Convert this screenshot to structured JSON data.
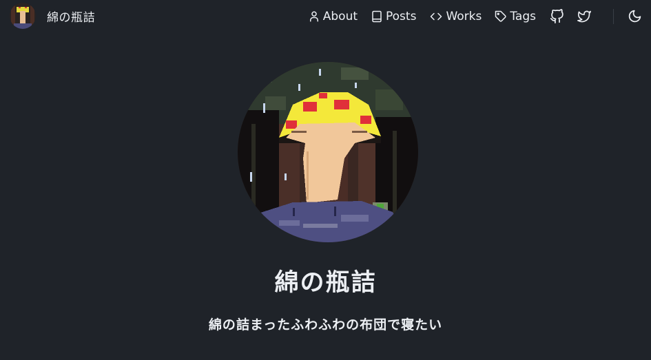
{
  "brand": {
    "title": "綿の瓶詰",
    "avatar_icon": "mushroom-avatar-icon"
  },
  "nav": {
    "items": [
      {
        "label": "About",
        "icon": "user-icon"
      },
      {
        "label": "Posts",
        "icon": "book-icon"
      },
      {
        "label": "Works",
        "icon": "code-icon"
      },
      {
        "label": "Tags",
        "icon": "tag-icon"
      }
    ],
    "github_icon": "github-icon",
    "twitter_icon": "twitter-icon",
    "theme_icon": "moon-icon"
  },
  "profile": {
    "title": "綿の瓶詰",
    "subtitle": "綿の詰まったふわふわの布団で寝たい",
    "avatar_icon": "mushroom-avatar-icon"
  },
  "colors": {
    "background": "#1f2329",
    "text": "#eceff3",
    "cap_yellow": "#f4e83a",
    "cap_spots": "#e0303a",
    "skin": "#f1c79a",
    "shirt": "#4e4f82"
  }
}
